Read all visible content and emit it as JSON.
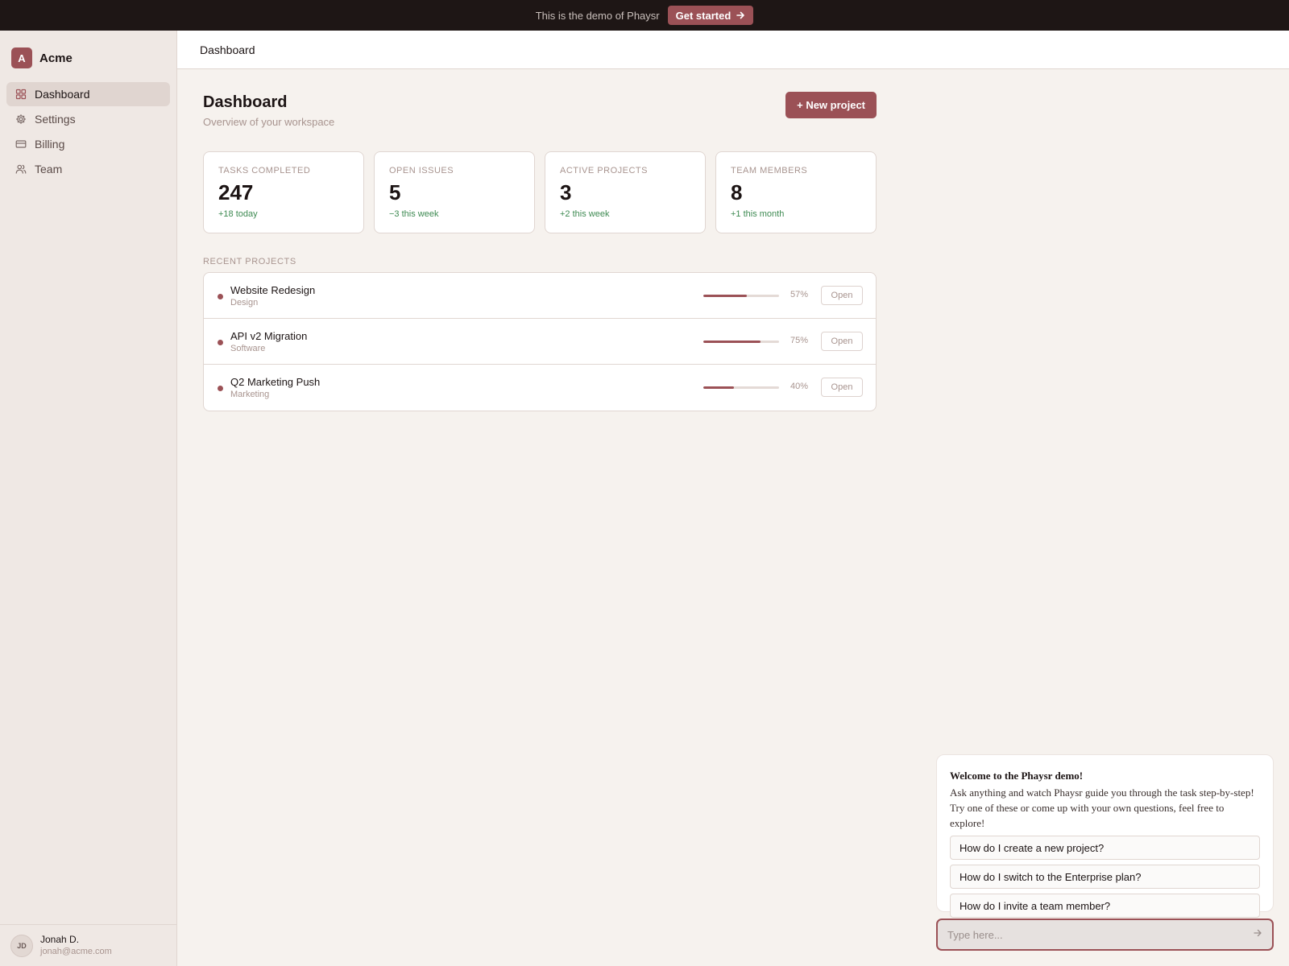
{
  "banner": {
    "text": "This is the demo of Phaysr",
    "cta_label": "Get started"
  },
  "sidebar": {
    "brand_initial": "A",
    "brand_name": "Acme",
    "items": [
      {
        "label": "Dashboard",
        "icon": "grid-icon",
        "active": true
      },
      {
        "label": "Settings",
        "icon": "gear-icon",
        "active": false
      },
      {
        "label": "Billing",
        "icon": "credit-card-icon",
        "active": false
      },
      {
        "label": "Team",
        "icon": "users-icon",
        "active": false
      }
    ],
    "user": {
      "initials": "JD",
      "name": "Jonah D.",
      "email": "jonah@acme.com"
    }
  },
  "header": {
    "breadcrumb": "Dashboard"
  },
  "main": {
    "title": "Dashboard",
    "subtitle": "Overview of your workspace",
    "new_project_label": "+ New project",
    "stats": [
      {
        "label": "TASKS COMPLETED",
        "value": "247",
        "delta": "+18 today"
      },
      {
        "label": "OPEN ISSUES",
        "value": "5",
        "delta": "−3 this week"
      },
      {
        "label": "ACTIVE PROJECTS",
        "value": "3",
        "delta": "+2 this week"
      },
      {
        "label": "TEAM MEMBERS",
        "value": "8",
        "delta": "+1 this month"
      }
    ],
    "recent_label": "RECENT PROJECTS",
    "projects": [
      {
        "name": "Website Redesign",
        "category": "Design",
        "progress": 57,
        "progress_label": "57%",
        "action": "Open"
      },
      {
        "name": "API v2 Migration",
        "category": "Software",
        "progress": 75,
        "progress_label": "75%",
        "action": "Open"
      },
      {
        "name": "Q2 Marketing Push",
        "category": "Marketing",
        "progress": 40,
        "progress_label": "40%",
        "action": "Open"
      }
    ]
  },
  "chat": {
    "title": "Welcome to the Phaysr demo!",
    "body": "Ask anything and watch Phaysr guide you through the task step-by-step! Try one of these or come up with your own questions, feel free to explore!",
    "suggestions": [
      "How do I create a new project?",
      "How do I switch to the Enterprise plan?",
      "How do I invite a team member?"
    ],
    "input_placeholder": "Type here..."
  },
  "colors": {
    "accent": "#9b5156",
    "banner_bg": "#1e1615",
    "sidebar_bg": "#efe8e4",
    "page_bg": "#f6f2ee",
    "positive": "#3e8a52"
  }
}
